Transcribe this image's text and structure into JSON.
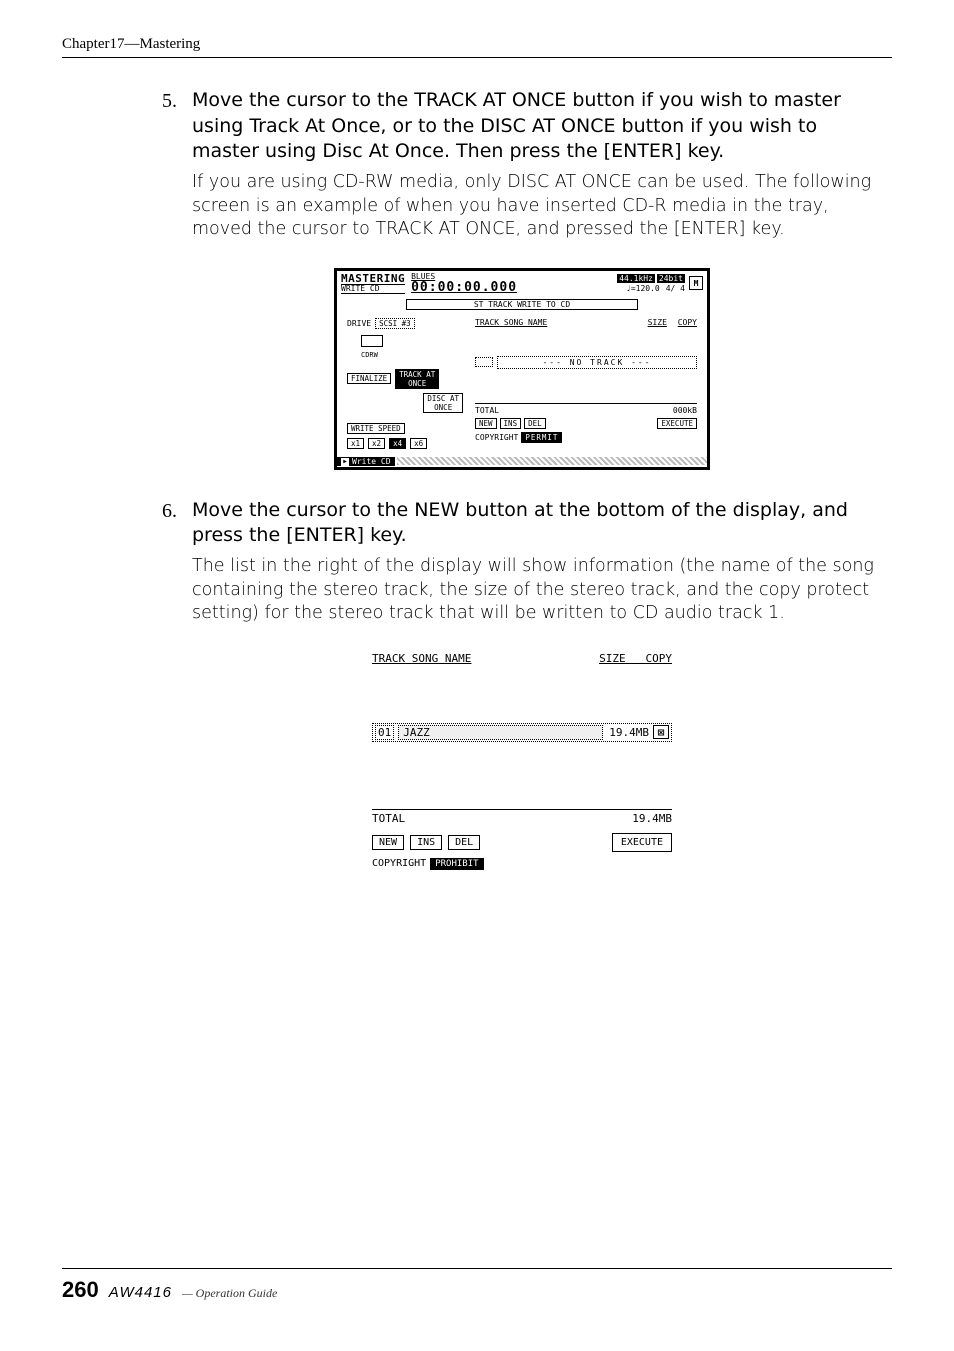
{
  "header": {
    "chapter": "Chapter17—Mastering"
  },
  "steps": [
    {
      "num": "5.",
      "instruction": "Move the cursor to the TRACK AT ONCE button if you wish to master using Track At Once, or to the DISC AT ONCE button if you wish to master using Disc At Once. Then press the [ENTER] key.",
      "note": "If you are using CD-RW media, only DISC AT ONCE can be used. The following screen is an example of when you have inserted CD-R media in the tray, moved the cursor to TRACK AT ONCE, and pressed the [ENTER] key."
    },
    {
      "num": "6.",
      "instruction": "Move the cursor to the NEW button at the bottom of the display, and press the [ENTER] key.",
      "note": "The list in the right of the display will show information (the name of the song containing the stereo track, the size of the stereo track, and the copy protect setting) for the stereo track that will be written to CD audio track 1."
    }
  ],
  "fig1": {
    "title": "MASTERING",
    "subtitle": "WRITE CD",
    "songname": "BLUES",
    "time": "00:00:00.000",
    "samplerate": "44.1kHz",
    "bitdepth": "24bit",
    "tempo": "=120.0",
    "timesig": "4/ 4",
    "m_icon": "M",
    "header_line": "ST TRACK WRITE TO CD",
    "left": {
      "drive_label": "DRIVE",
      "drive_value": "SCSI #3",
      "drive_type": "CDRW",
      "finalize": "FINALIZE",
      "track_at_once": "TRACK AT\nONCE",
      "disc_at_once": "DISC AT\nONCE",
      "write_speed": "WRITE SPEED",
      "speeds": [
        "x1",
        "x2",
        "x4",
        "x6"
      ],
      "speed_selected": "x4"
    },
    "right": {
      "col_track": "TRACK",
      "col_song": "SONG NAME",
      "col_size": "SIZE",
      "col_copy": "COPY",
      "no_track": "--- NO TRACK ---",
      "total_label": "TOTAL",
      "total_value": "000kB",
      "new": "NEW",
      "ins": "INS",
      "del": "DEL",
      "execute": "EXECUTE",
      "copyright_label": "COPYRIGHT",
      "copyright_value": "PERMIT"
    },
    "tab": "Write CD"
  },
  "fig2": {
    "col_track": "TRACK",
    "col_song": "SONG NAME",
    "col_size": "SIZE",
    "col_copy": "COPY",
    "row": {
      "num": "01",
      "song": "JAZZ",
      "size": "19.4MB",
      "copy": "⊠"
    },
    "total_label": "TOTAL",
    "total_value": "19.4MB",
    "new": "NEW",
    "ins": "INS",
    "del": "DEL",
    "execute": "EXECUTE",
    "copyright_label": "COPYRIGHT",
    "copyright_value": "PROHIBIT"
  },
  "footer": {
    "page": "260",
    "model": "AW4416",
    "guide": "— Operation Guide"
  }
}
